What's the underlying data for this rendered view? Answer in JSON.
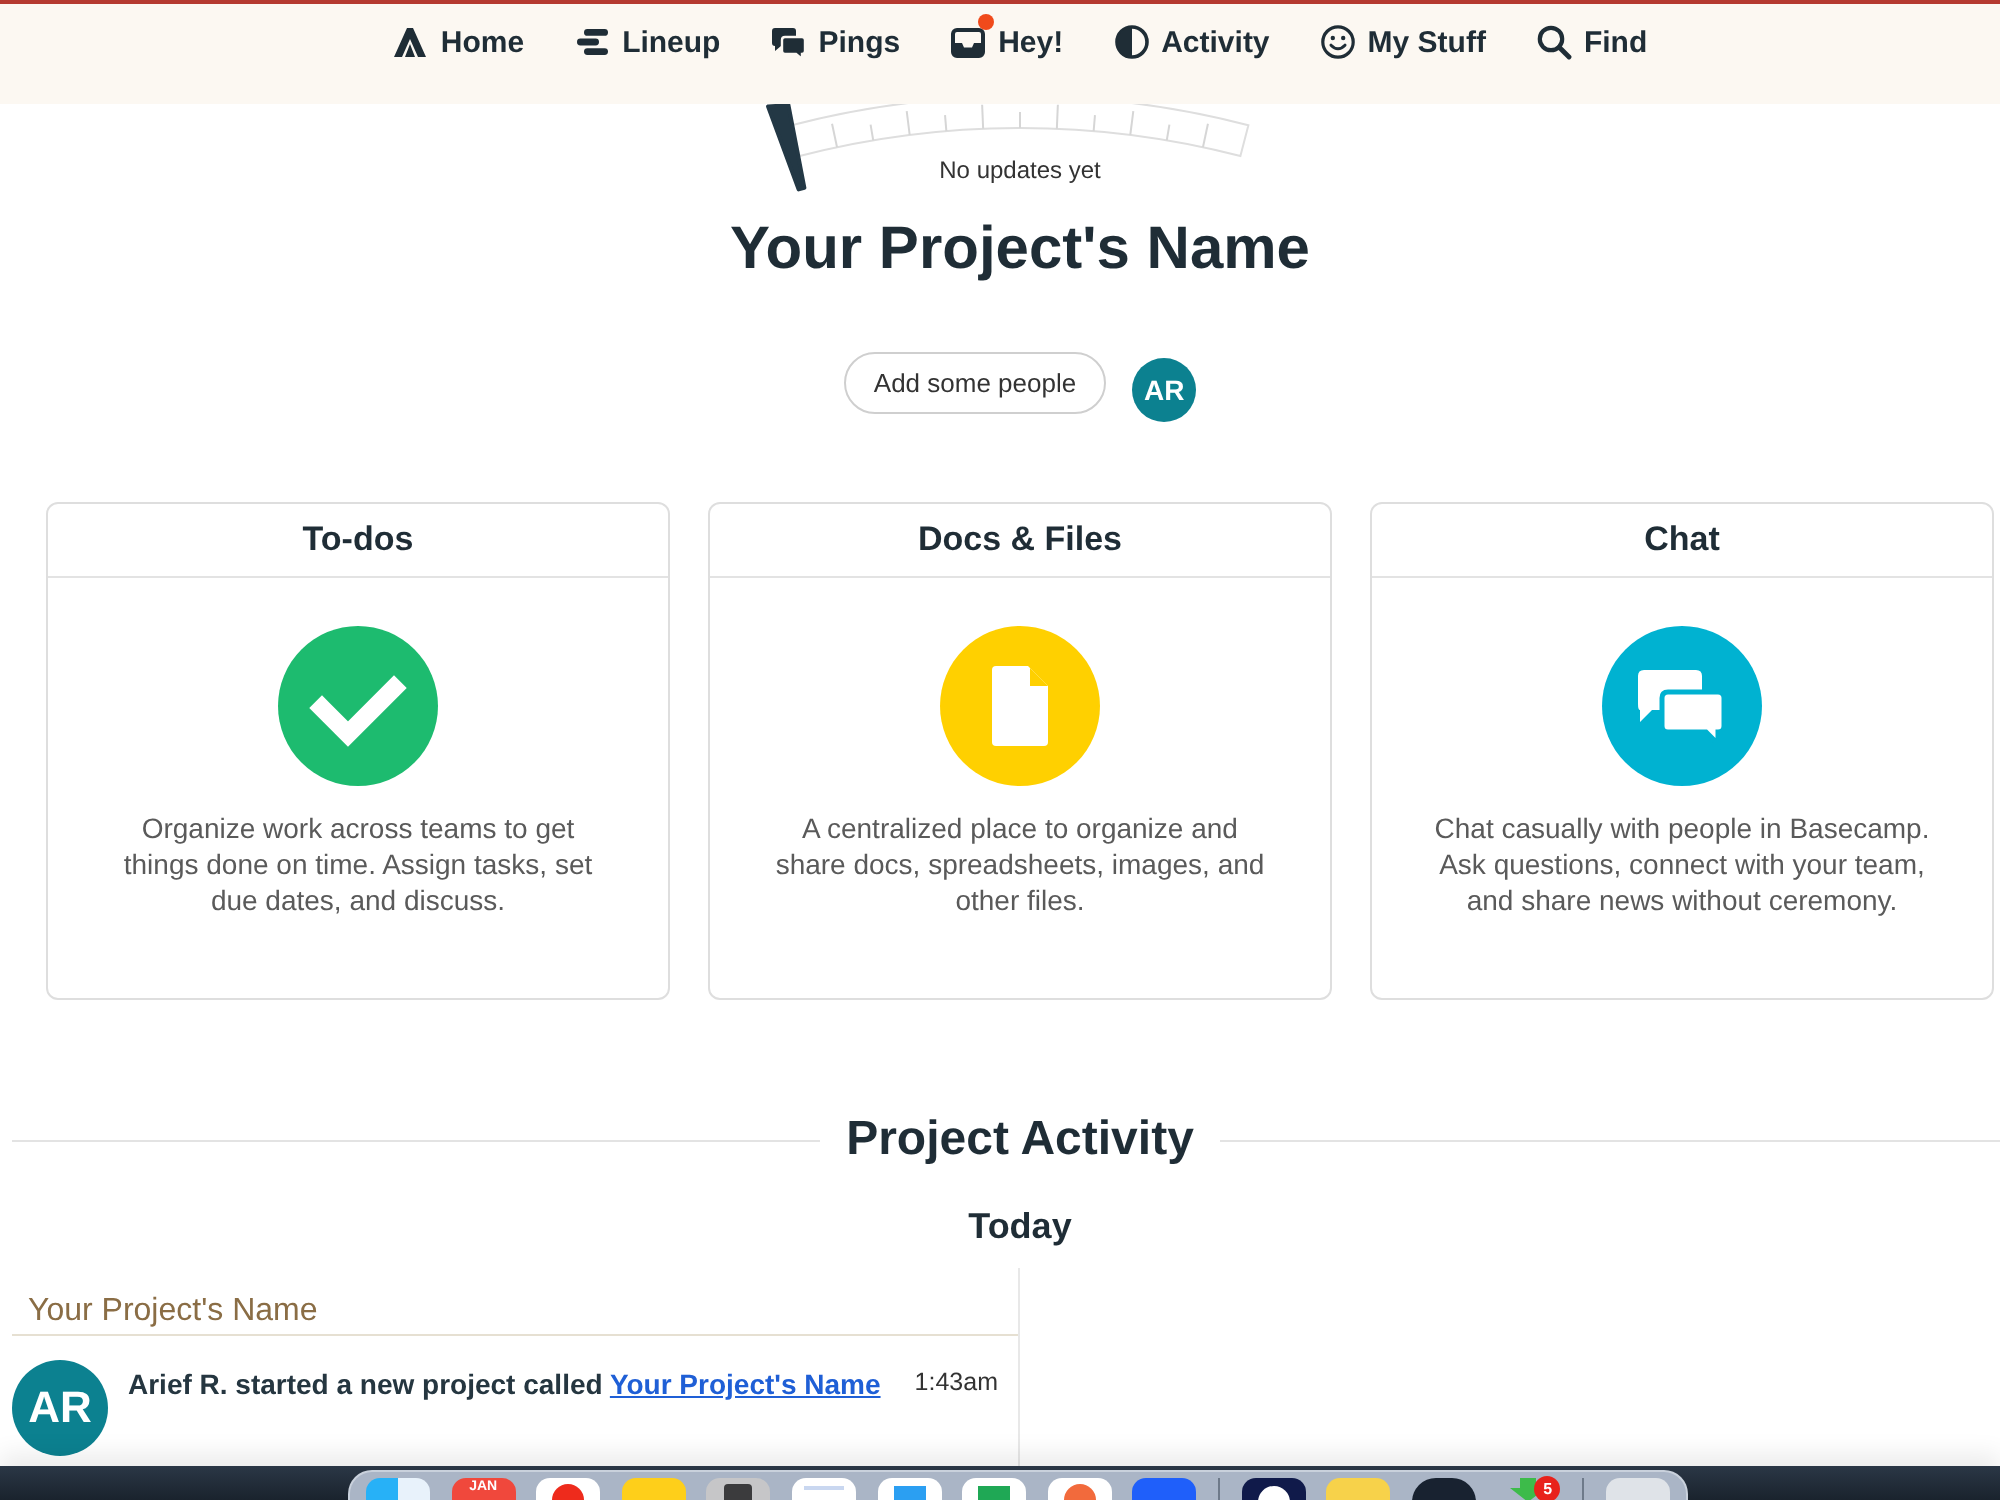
{
  "nav": [
    {
      "label": "Home",
      "unread": false
    },
    {
      "label": "Lineup",
      "unread": false
    },
    {
      "label": "Pings",
      "unread": false
    },
    {
      "label": "Hey!",
      "unread": true
    },
    {
      "label": "Activity",
      "unread": false
    },
    {
      "label": "My Stuff",
      "unread": false
    },
    {
      "label": "Find",
      "unread": false
    }
  ],
  "gauge": {
    "level": 0,
    "caption": "No updates yet"
  },
  "project": {
    "title": "Your Project's Name",
    "add_people": "Add some people",
    "avatar": "AR"
  },
  "tools": [
    {
      "title": "To-dos",
      "description": "Organize work across teams to get things done on time. Assign tasks, set due dates, and discuss."
    },
    {
      "title": "Docs & Files",
      "description": "A centralized place to organize and share docs, spreadsheets, images, and other files."
    },
    {
      "title": "Chat",
      "description": "Chat casually with people in Basecamp. Ask questions, connect with your team, and share news without ceremony."
    }
  ],
  "activity": {
    "heading": "Project Activity",
    "day": "Today",
    "project": "Your Project's Name",
    "events": [
      {
        "avatar": "AR",
        "text": "Arief R. started a new project called",
        "link": "Your Project's Name",
        "time": "1:43am"
      }
    ]
  },
  "dock": {
    "calendar_month": "JAN",
    "badge": "5"
  }
}
